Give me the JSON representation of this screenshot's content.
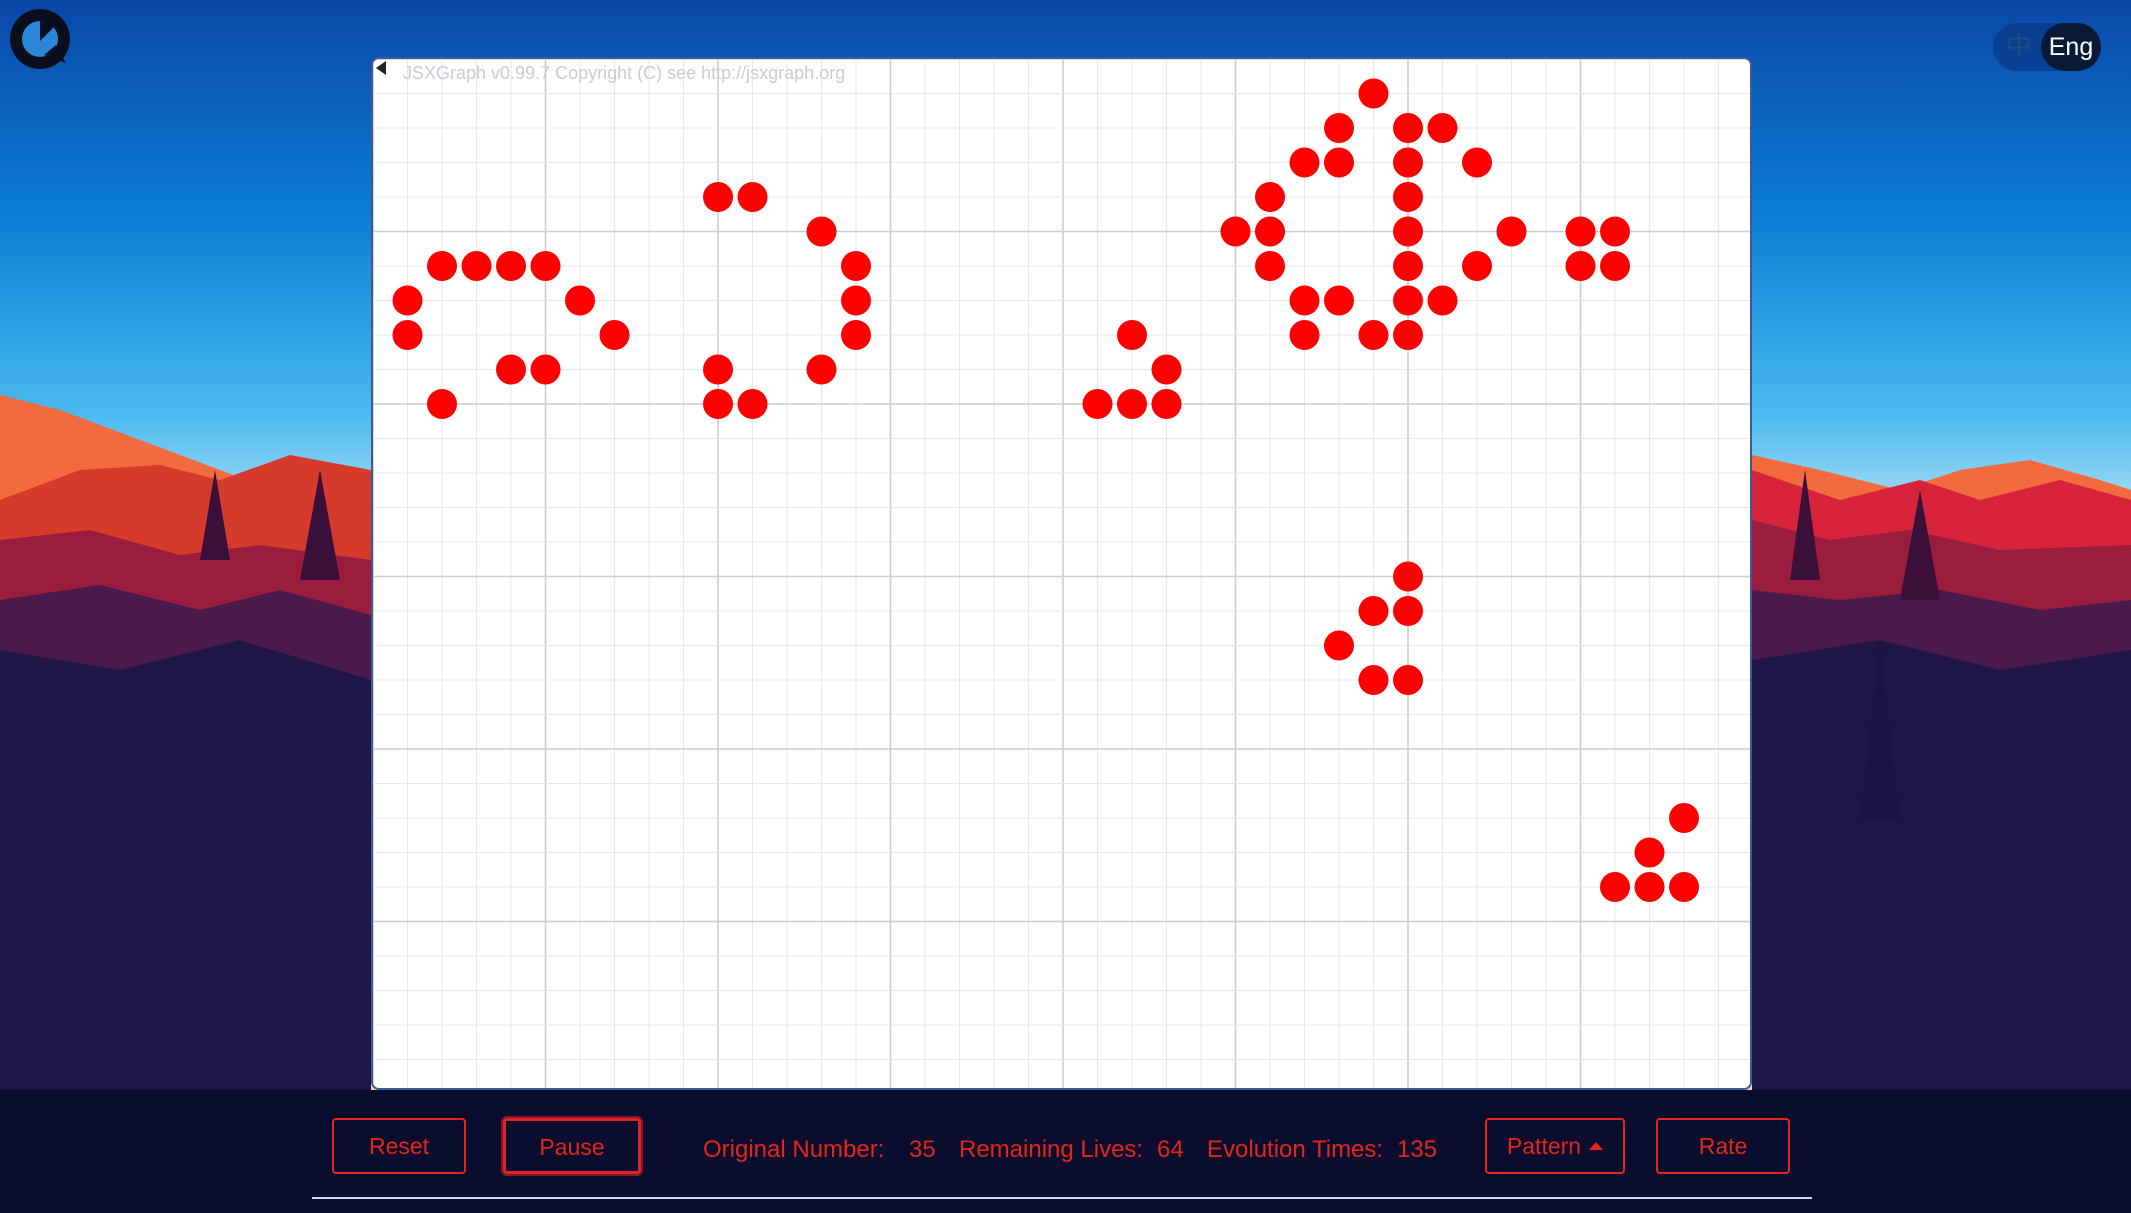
{
  "app": {
    "copyright": "JSXGraph v0.99.7 Copyright (C) see http://jsxgraph.org",
    "accent_color": "#e5251a",
    "cell_color": "#ff0000"
  },
  "language": {
    "zh_label": "中",
    "en_label": "Eng",
    "selected": "Eng"
  },
  "controls": {
    "reset_label": "Reset",
    "pause_label": "Pause",
    "pattern_label": "Pattern",
    "rate_label": "Rate"
  },
  "stats": {
    "original_label": "Original Number:",
    "original_value": "35",
    "remaining_label": "Remaining Lives:",
    "remaining_value": "64",
    "evolution_label": "Evolution Times:",
    "evolution_value": "135"
  },
  "board": {
    "grid_columns": 40,
    "grid_rows": 30,
    "live_cells": [
      [
        1,
        7
      ],
      [
        1,
        8
      ],
      [
        2,
        6
      ],
      [
        2,
        10
      ],
      [
        3,
        6
      ],
      [
        4,
        6
      ],
      [
        4,
        9
      ],
      [
        5,
        6
      ],
      [
        5,
        9
      ],
      [
        6,
        7
      ],
      [
        7,
        8
      ],
      [
        10,
        4
      ],
      [
        10,
        9
      ],
      [
        10,
        10
      ],
      [
        11,
        4
      ],
      [
        11,
        10
      ],
      [
        13,
        5
      ],
      [
        13,
        9
      ],
      [
        14,
        6
      ],
      [
        14,
        7
      ],
      [
        14,
        8
      ],
      [
        21,
        10
      ],
      [
        22,
        8
      ],
      [
        22,
        10
      ],
      [
        23,
        9
      ],
      [
        23,
        10
      ],
      [
        25,
        5
      ],
      [
        26,
        4
      ],
      [
        26,
        5
      ],
      [
        26,
        6
      ],
      [
        27,
        3
      ],
      [
        27,
        7
      ],
      [
        27,
        8
      ],
      [
        28,
        2
      ],
      [
        28,
        3
      ],
      [
        28,
        7
      ],
      [
        29,
        1
      ],
      [
        29,
        8
      ],
      [
        30,
        2
      ],
      [
        30,
        3
      ],
      [
        30,
        4
      ],
      [
        30,
        5
      ],
      [
        30,
        6
      ],
      [
        30,
        7
      ],
      [
        30,
        8
      ],
      [
        31,
        2
      ],
      [
        31,
        7
      ],
      [
        32,
        3
      ],
      [
        32,
        6
      ],
      [
        33,
        5
      ],
      [
        28,
        17
      ],
      [
        29,
        18
      ],
      [
        29,
        16
      ],
      [
        30,
        18
      ],
      [
        30,
        16
      ],
      [
        30,
        15
      ],
      [
        35,
        5
      ],
      [
        35,
        6
      ],
      [
        36,
        5
      ],
      [
        36,
        6
      ],
      [
        36,
        24
      ],
      [
        37,
        24
      ],
      [
        37,
        23
      ],
      [
        38,
        24
      ],
      [
        38,
        22
      ]
    ]
  }
}
